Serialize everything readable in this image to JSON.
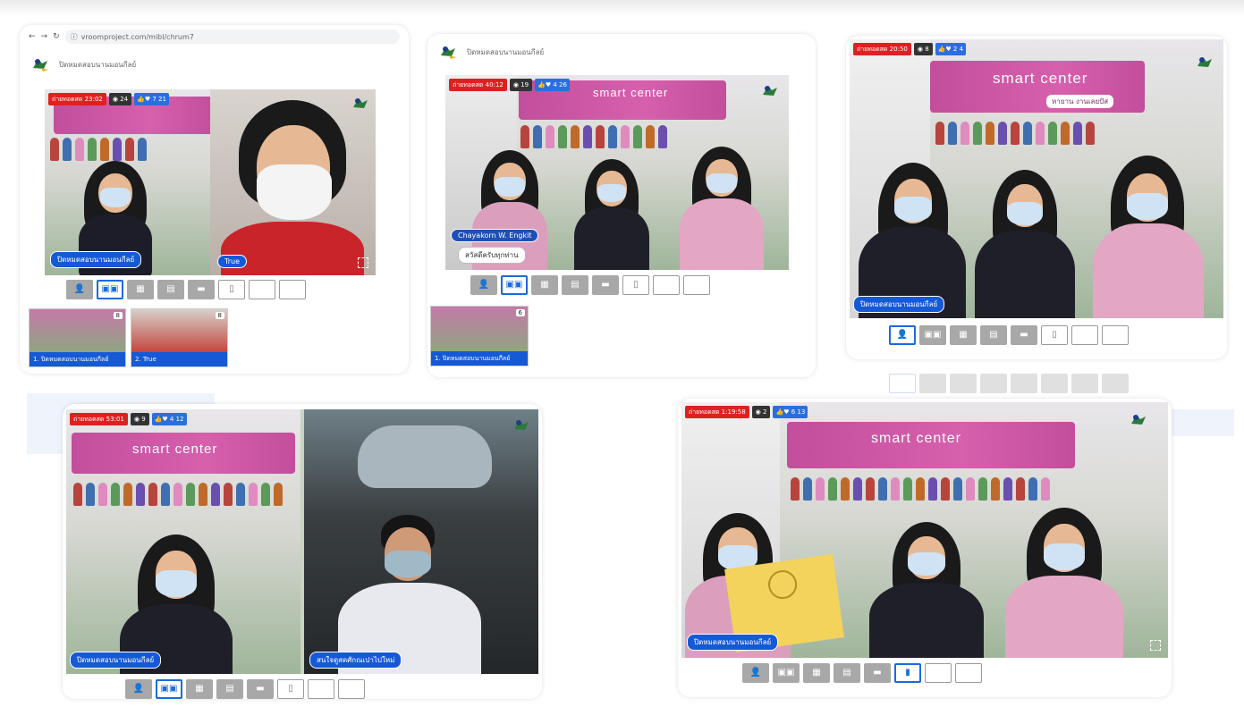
{
  "colors": {
    "live": "#e02020",
    "label_blue": "#1559d6",
    "active_layout": "#1a6be0",
    "banner_pink": "#cd56a4"
  },
  "icons": {
    "back": "arrow-left-icon",
    "forward": "arrow-right-icon",
    "reload": "reload-icon",
    "info": "info-icon",
    "eye": "eye-icon",
    "like": "like-icon",
    "heart": "heart-icon",
    "fullscreen": "fullscreen-icon",
    "layout": "layout-icon"
  },
  "panel1": {
    "url": "vroomproject.com/mibl/chrum7",
    "app_title": "ปิดหมดสอบนานมอนกีลย์",
    "live": "ถ่ายทอดสด 23:02",
    "viewers": "24",
    "reactions": "7 21",
    "label_main": "ปิดหมดสอบนานมอนกีลย์",
    "label_guest": "True",
    "thumbs": [
      {
        "caption": "1. ปิดหมดสอบนานมอนกีลย์",
        "count": "8"
      },
      {
        "caption": "2. True",
        "count": "8"
      }
    ]
  },
  "panel2": {
    "app_title": "ปิดหมดสอบนานมอนกีลย์",
    "live": "ถ่ายทอดสด 40:12",
    "viewers": "19",
    "reactions": "4 26",
    "chip_name": "Chayakorn W. Engkit",
    "chip_message": "สวัสดีครับทุกท่าน",
    "thumbs": [
      {
        "caption": "1. ปิดหมดสอบนานมอนกีลย์",
        "count": "6"
      }
    ]
  },
  "panel3": {
    "live": "ถ่ายทอดสด 20:50",
    "viewers": "8",
    "reactions": "2 4",
    "label_main": "ปิดหมดสอบนานมอนกีลย์"
  },
  "panel4": {
    "live": "ถ่ายทอดสด 53:01",
    "viewers": "9",
    "reactions": "4 12",
    "label_main": "ปิดหมดสอบนานมอนกีลย์",
    "label_guest": "สนใจดูสดศักณเปาไปใหม่"
  },
  "panel5": {
    "live": "ถ่ายทอดสด 1:19:58",
    "viewers": "2",
    "reactions": "6 13",
    "label_main": "ปิดหมดสอบนานมอนกีลย์"
  },
  "banner": {
    "title": "smart center",
    "subtitle": "หายาน งานเลยปัส"
  }
}
